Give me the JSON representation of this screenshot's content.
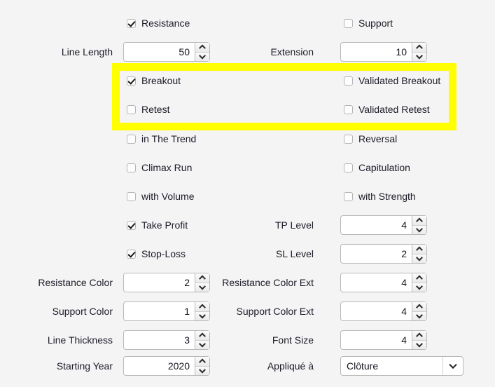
{
  "background_color": "#f4f4f4",
  "highlight": {
    "color": "#ffff00",
    "name": "breakout-retest-highlight"
  },
  "rows": [
    {
      "id": "resistance-support",
      "type": "checkbox-pair",
      "left": {
        "label": "Resistance",
        "checked": true
      },
      "right": {
        "label": "Support",
        "checked": false
      }
    },
    {
      "id": "line-length-extension",
      "type": "spinner-pair",
      "left": {
        "label": "Line Length",
        "value": "50"
      },
      "right": {
        "label": "Extension",
        "value": "10"
      }
    },
    {
      "id": "breakout-validated-breakout",
      "type": "checkbox-pair",
      "left": {
        "label": "Breakout",
        "checked": true
      },
      "right": {
        "label": "Validated Breakout",
        "checked": false
      }
    },
    {
      "id": "retest-validated-retest",
      "type": "checkbox-pair",
      "left": {
        "label": "Retest",
        "checked": false
      },
      "right": {
        "label": "Validated Retest",
        "checked": false
      }
    },
    {
      "id": "in-the-trend-reversal",
      "type": "checkbox-pair",
      "left": {
        "label": "in The Trend",
        "checked": false
      },
      "right": {
        "label": "Reversal",
        "checked": false
      }
    },
    {
      "id": "climax-run-capitulation",
      "type": "checkbox-pair",
      "left": {
        "label": "Climax Run",
        "checked": false
      },
      "right": {
        "label": "Capitulation",
        "checked": false
      }
    },
    {
      "id": "with-volume-with-strength",
      "type": "checkbox-pair",
      "left": {
        "label": "with Volume",
        "checked": false
      },
      "right": {
        "label": "with Strength",
        "checked": false
      }
    },
    {
      "id": "take-profit-tp-level",
      "type": "checkbox-spinner",
      "left": {
        "label": "Take Profit",
        "checked": true
      },
      "right": {
        "label": "TP Level",
        "value": "4"
      }
    },
    {
      "id": "stop-loss-sl-level",
      "type": "checkbox-spinner",
      "left": {
        "label": "Stop-Loss",
        "checked": true
      },
      "right": {
        "label": "SL Level",
        "value": "2"
      }
    },
    {
      "id": "resistance-color",
      "type": "spinner-pair",
      "left": {
        "label": "Resistance Color",
        "value": "2"
      },
      "right": {
        "label": "Resistance Color Ext",
        "value": "4"
      }
    },
    {
      "id": "support-color",
      "type": "spinner-pair",
      "left": {
        "label": "Support Color",
        "value": "1"
      },
      "right": {
        "label": "Support Color Ext",
        "value": "4"
      }
    },
    {
      "id": "line-thickness-font-size",
      "type": "spinner-pair",
      "left": {
        "label": "Line Thickness",
        "value": "3"
      },
      "right": {
        "label": "Font Size",
        "value": "4"
      }
    },
    {
      "id": "starting-year-applique-a",
      "type": "spinner-select",
      "left": {
        "label": "Starting Year",
        "value": "2020"
      },
      "right": {
        "label": "Appliqué à",
        "value": "Clôture"
      }
    }
  ]
}
